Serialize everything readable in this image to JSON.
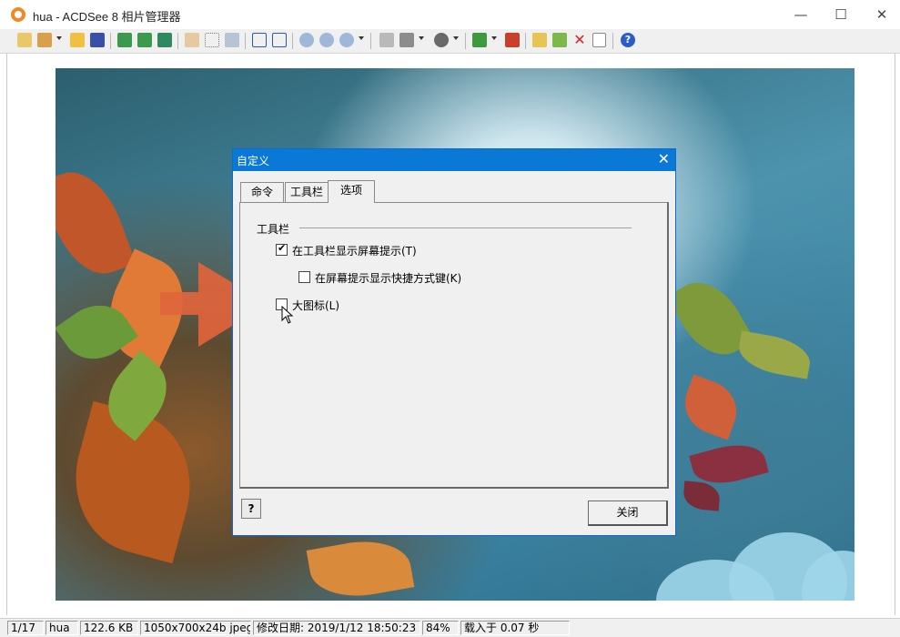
{
  "window": {
    "title": "hua - ACDSee 8 相片管理器",
    "minimize": "—",
    "maximize": "☐",
    "close": "✕"
  },
  "toolbar": {
    "icons": [
      "browse-icon",
      "edit-icon",
      "open-folder-icon",
      "save-icon",
      "previous-image-icon",
      "next-image-icon",
      "autoplay-icon",
      "pan-hand-icon",
      "select-icon",
      "zoom-tool-icon",
      "rotate-left-icon",
      "rotate-right-icon",
      "zoom-in-icon",
      "zoom-out-icon",
      "zoom-menu-icon",
      "print-icon",
      "scan-icon",
      "view-mode-icon",
      "desktop-icon",
      "wallpaper-icon",
      "copy-icon",
      "move-icon",
      "delete-icon",
      "properties-icon",
      "help-icon"
    ]
  },
  "dialog": {
    "title": "自定义",
    "tabs": [
      "命令",
      "工具栏",
      "选项"
    ],
    "active_tab": "选项",
    "group_label": "工具栏",
    "options": [
      {
        "label": "在工具栏显示屏幕提示(T)",
        "checked": true
      },
      {
        "label": "在屏幕提示显示快捷方式键(K)",
        "checked": false
      },
      {
        "label": "大图标(L)",
        "checked": false
      }
    ],
    "help_button": "?",
    "close_button": "关闭"
  },
  "statusbar": {
    "position": "1/17",
    "name": "hua",
    "size": "122.6 KB",
    "dimensions": "1050x700x24b jpeg",
    "modified": "修改日期: 2019/1/12 18:50:23",
    "zoom": "84%",
    "load_time": "载入于 0.07 秒"
  },
  "colors": {
    "accent": "#0a78d7",
    "arrow": "#e0643c"
  }
}
